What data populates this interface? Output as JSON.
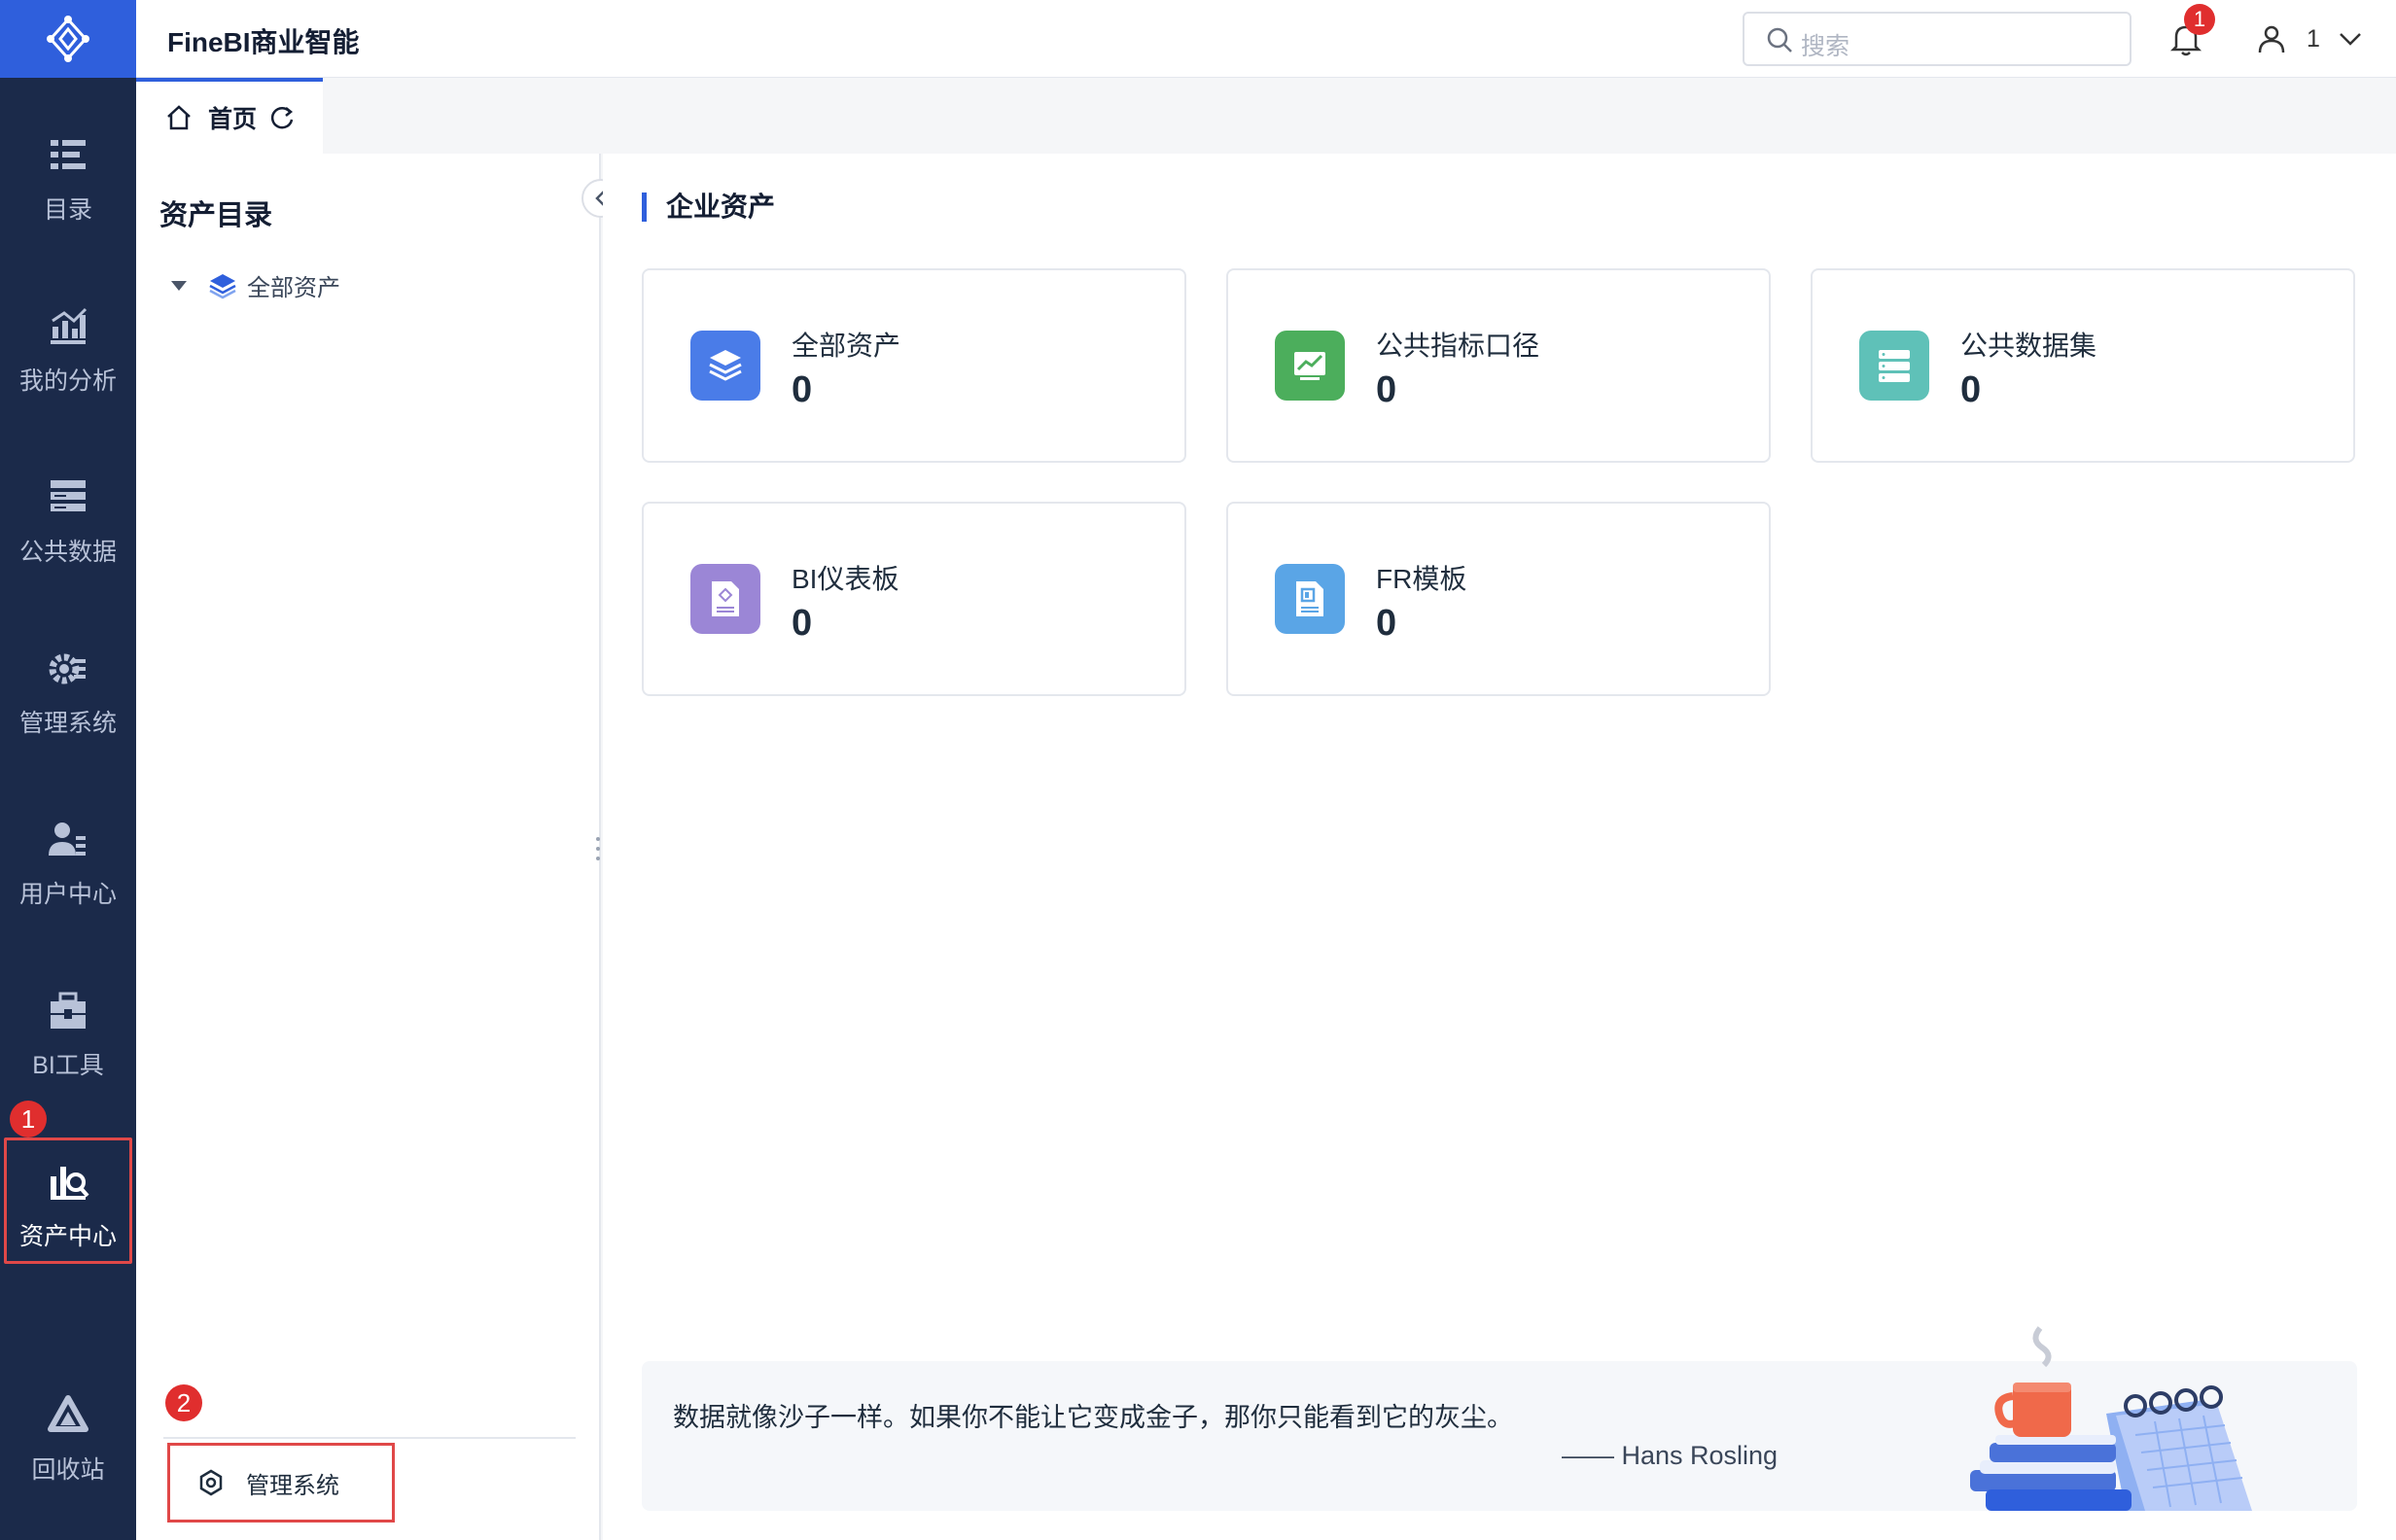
{
  "app": {
    "title": "FineBI商业智能"
  },
  "topbar": {
    "search_placeholder": "搜索",
    "notification_count": "1",
    "user_name": "1"
  },
  "tabs": [
    {
      "label": "首页"
    }
  ],
  "nav": {
    "items": [
      {
        "label": "目录",
        "icon": "catalog-icon"
      },
      {
        "label": "我的分析",
        "icon": "analysis-icon"
      },
      {
        "label": "公共数据",
        "icon": "public-data-icon"
      },
      {
        "label": "管理系统",
        "icon": "gear-icon"
      },
      {
        "label": "用户中心",
        "icon": "user-icon"
      },
      {
        "label": "BI工具",
        "icon": "toolbox-icon"
      },
      {
        "label": "资产中心",
        "icon": "asset-search-icon",
        "active": true
      },
      {
        "label": "回收站",
        "icon": "recycle-icon"
      }
    ]
  },
  "markers": {
    "step1": "1",
    "step2": "2"
  },
  "tree": {
    "title": "资产目录",
    "root_label": "全部资产",
    "manage_label": "管理系统"
  },
  "main": {
    "section_title": "企业资产",
    "cards": [
      {
        "label": "全部资产",
        "value": "0",
        "color": "#4a7ce8"
      },
      {
        "label": "公共指标口径",
        "value": "0",
        "color": "#4cae5c"
      },
      {
        "label": "公共数据集",
        "value": "0",
        "color": "#5fc1b8"
      },
      {
        "label": "BI仪表板",
        "value": "0",
        "color": "#9b86d6"
      },
      {
        "label": "FR模板",
        "value": "0",
        "color": "#5aa5e6"
      }
    ],
    "quote": {
      "text": "数据就像沙子一样。如果你不能让它变成金子，那你只能看到它的灰尘。",
      "author": "—— Hans Rosling"
    }
  },
  "colors": {
    "nav_bg": "#1b2a4a",
    "brand": "#2f5fdc",
    "highlight_red": "#e04848"
  }
}
